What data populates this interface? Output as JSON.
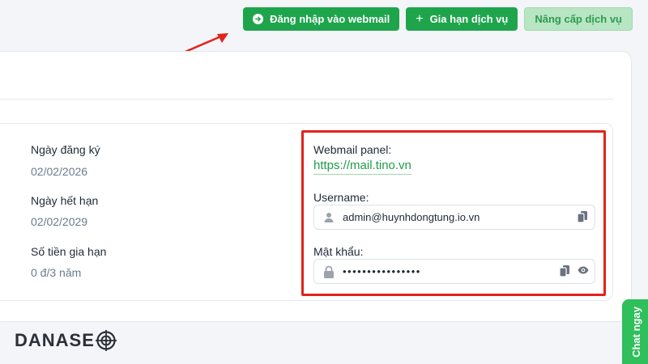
{
  "toolbar": {
    "login_label": "Đăng nhập vào webmail",
    "renew_label": "Gia hạn dịch vụ",
    "upgrade_label": "Nâng cấp dịch vụ"
  },
  "details": {
    "reg_date_label": "Ngày đăng ký",
    "reg_date_value": "02/02/2026",
    "exp_date_label": "Ngày hết hạn",
    "exp_date_value": "02/02/2029",
    "renew_price_label": "Số tiền gia hạn",
    "renew_price_value": "0 đ/3 năm"
  },
  "webmail": {
    "panel_label": "Webmail panel:",
    "panel_url": "https://mail.tino.vn",
    "username_label": "Username:",
    "username_value": "admin@huynhdongtung.io.vn",
    "password_label": "Mật khẩu:",
    "password_mask": "••••••••••••••••"
  },
  "chat_label": "Chat ngay",
  "logo_text": "DANASE",
  "colors": {
    "primary_green": "#1ea54c",
    "annotation_red": "#e0241b"
  }
}
